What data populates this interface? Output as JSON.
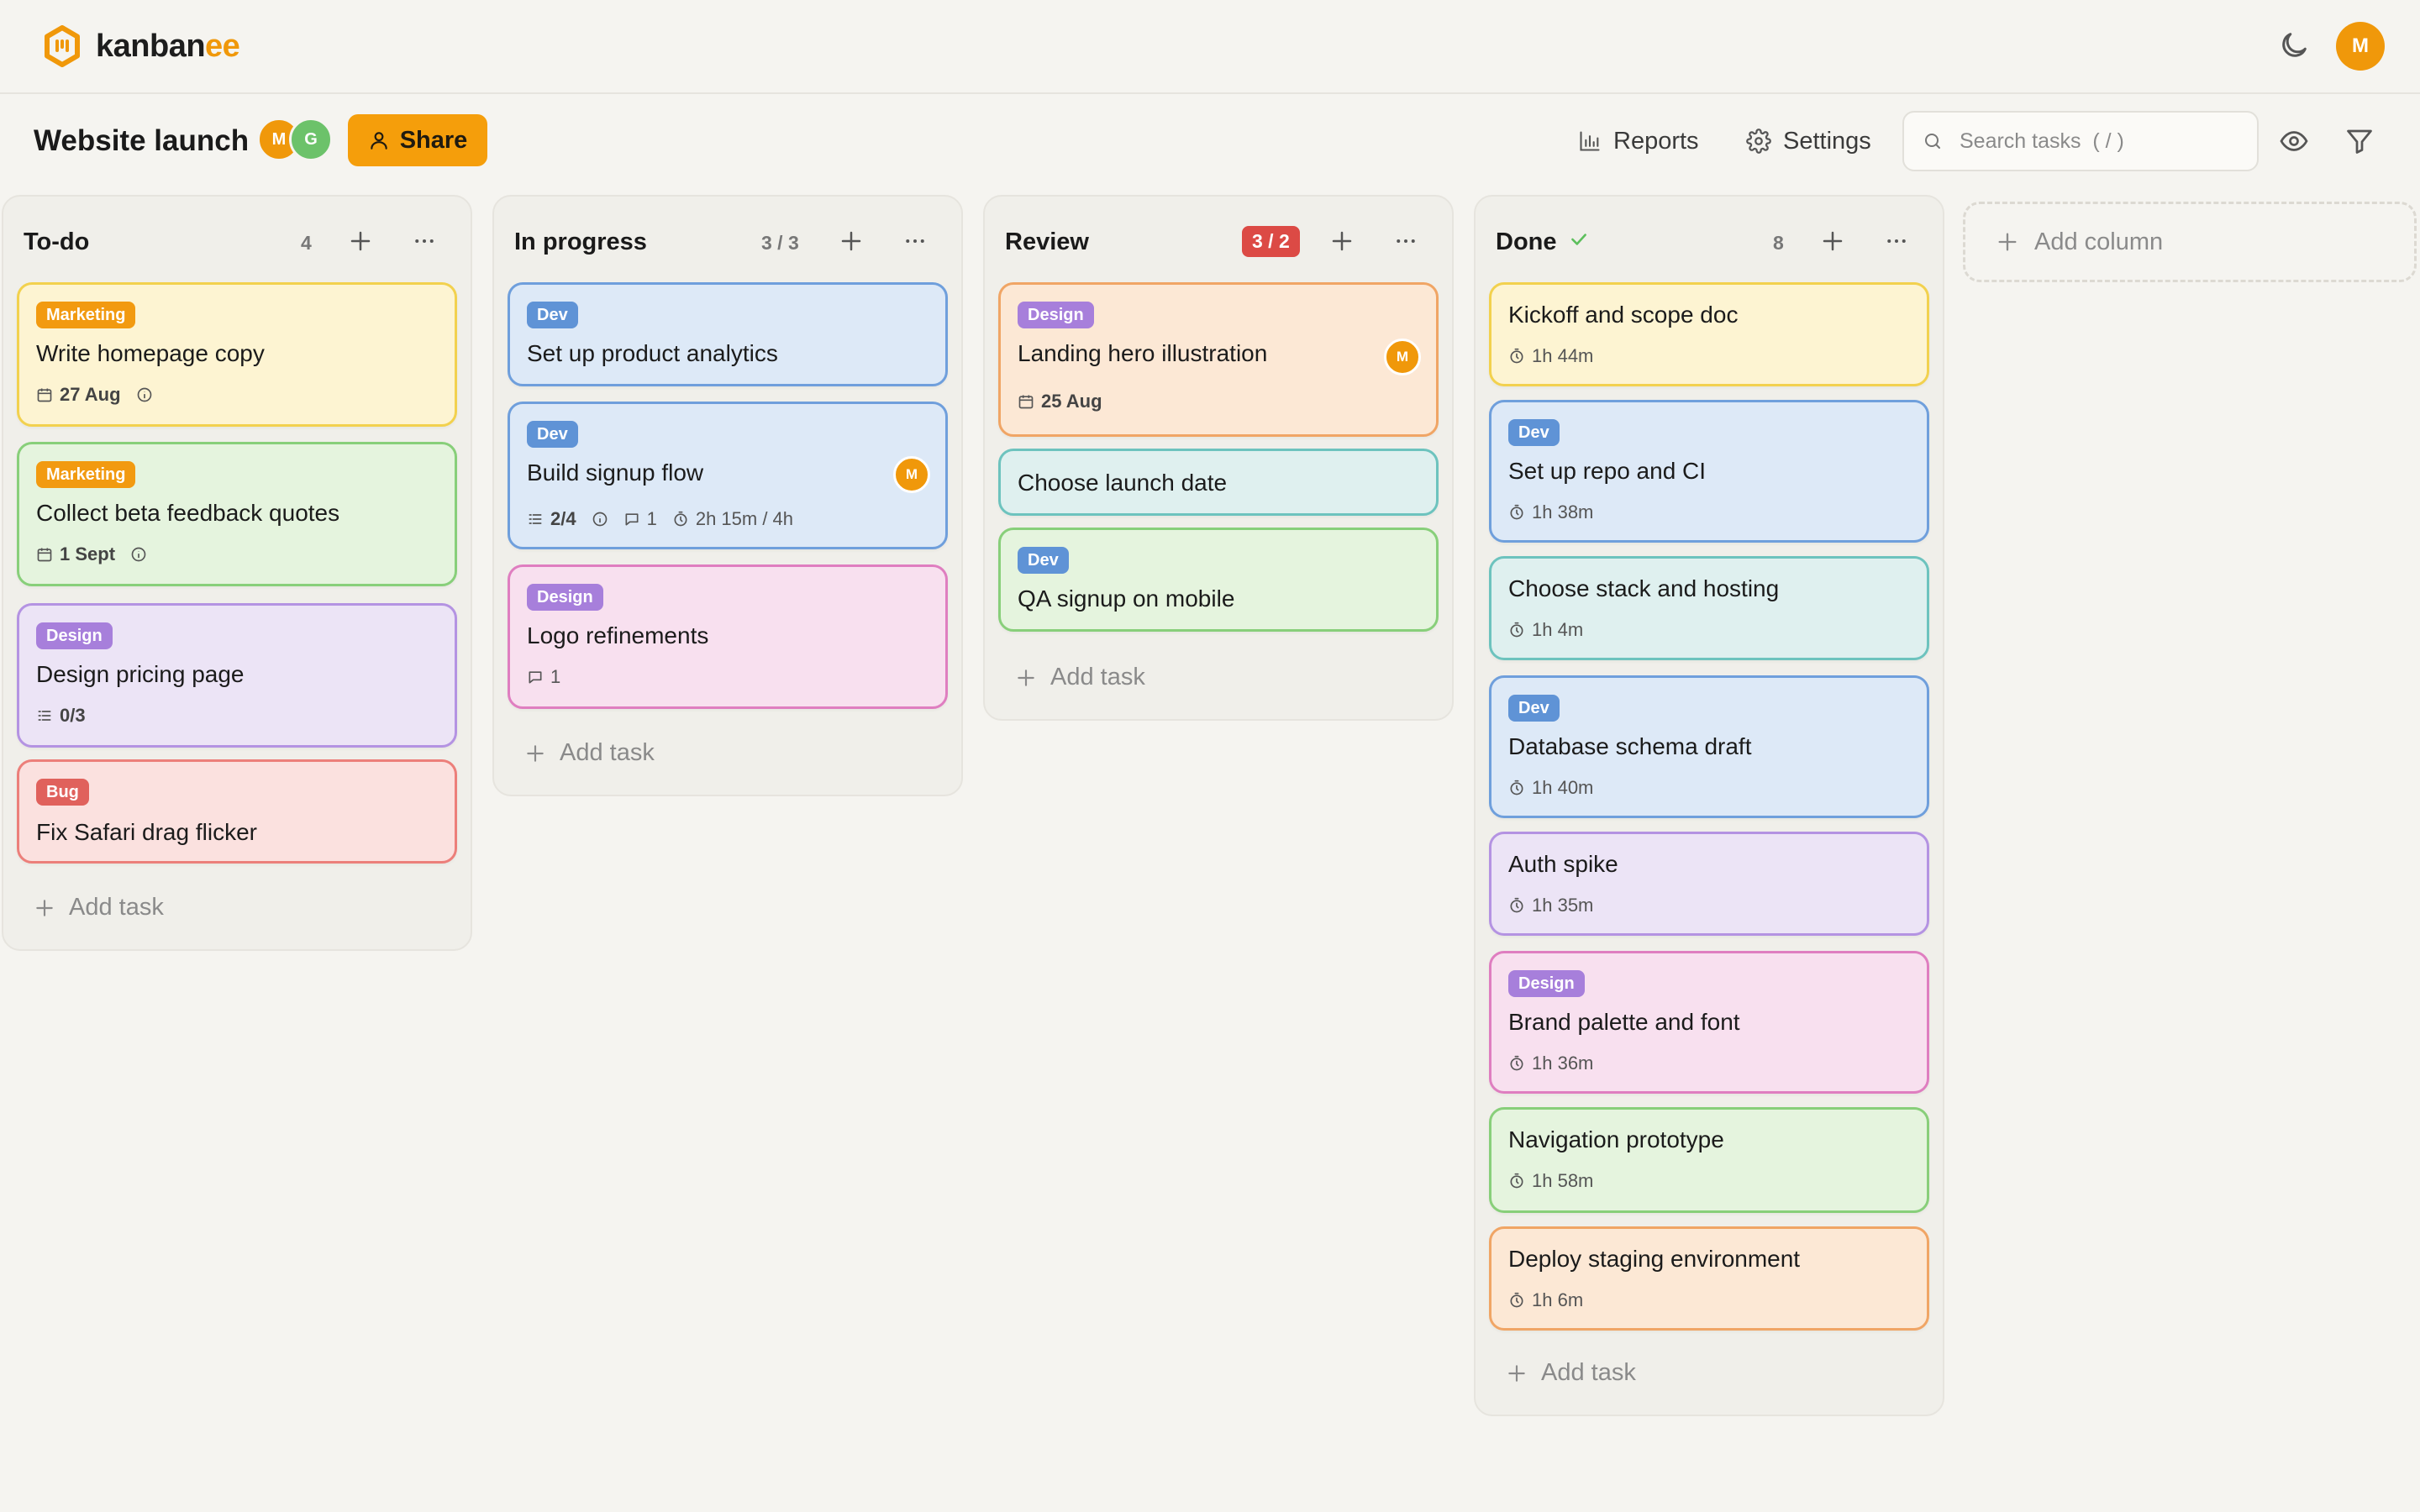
{
  "app": {
    "logo_text_main": "kanban",
    "logo_text_accent": "ee",
    "user_initial": "M",
    "accent_color": "#f0980a"
  },
  "board": {
    "title": "Website launch",
    "members": [
      "M",
      "G"
    ],
    "share_label": "Share",
    "reports_label": "Reports",
    "settings_label": "Settings",
    "search_placeholder": "Search tasks  ( / )"
  },
  "columns": [
    {
      "title": "To-do",
      "count": "4",
      "add_task_label": "Add task",
      "cards": [
        {
          "tag": "Marketing",
          "title": "Write homepage copy",
          "date": "27 Aug"
        },
        {
          "tag": "Marketing",
          "title": "Collect beta feedback quotes",
          "date": "1 Sept"
        },
        {
          "tag": "Design",
          "title": "Design pricing page",
          "checklist": "0/3"
        },
        {
          "tag": "Bug",
          "title": "Fix Safari drag flicker"
        }
      ]
    },
    {
      "title": "In progress",
      "count": "3 / 3",
      "add_task_label": "Add task",
      "cards": [
        {
          "tag": "Dev",
          "title": "Set up product analytics"
        },
        {
          "tag": "Dev",
          "title": "Build signup flow",
          "checklist": "2/4",
          "comments": "1",
          "time": "2h 15m / 4h",
          "assignee": "M"
        },
        {
          "tag": "Design",
          "title": "Logo refinements",
          "comments": "1"
        }
      ]
    },
    {
      "title": "Review",
      "count": "3 / 2",
      "add_task_label": "Add task",
      "cards": [
        {
          "tag": "Design",
          "title": "Landing hero illustration",
          "date": "25 Aug",
          "assignee": "M"
        },
        {
          "title": "Choose launch date"
        },
        {
          "tag": "Dev",
          "title": "QA signup on mobile"
        }
      ]
    },
    {
      "title": "Done",
      "count": "8",
      "add_task_label": "Add task",
      "cards": [
        {
          "title": "Kickoff and scope doc",
          "time": "1h 44m"
        },
        {
          "tag": "Dev",
          "title": "Set up repo and CI",
          "time": "1h 38m"
        },
        {
          "title": "Choose stack and hosting",
          "time": "1h 4m"
        },
        {
          "tag": "Dev",
          "title": "Database schema draft",
          "time": "1h 40m"
        },
        {
          "title": "Auth spike",
          "time": "1h 35m"
        },
        {
          "tag": "Design",
          "title": "Brand palette and font",
          "time": "1h 36m"
        },
        {
          "title": "Navigation prototype",
          "time": "1h 58m"
        },
        {
          "title": "Deploy staging environment",
          "time": "1h 6m"
        }
      ]
    }
  ],
  "add_column_label": "Add column"
}
